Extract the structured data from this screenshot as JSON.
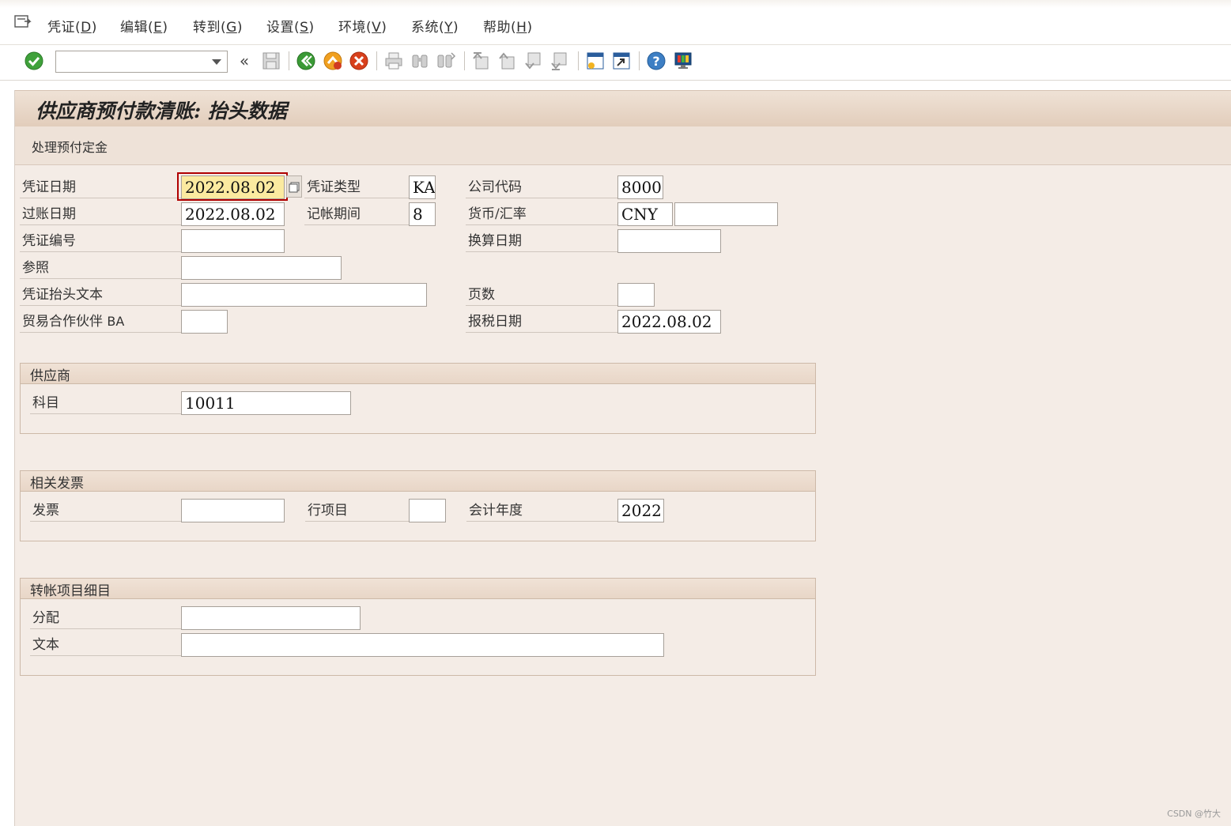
{
  "menubar": {
    "items": [
      {
        "label": "凭证",
        "key": "D"
      },
      {
        "label": "编辑",
        "key": "E"
      },
      {
        "label": "转到",
        "key": "G"
      },
      {
        "label": "设置",
        "key": "S"
      },
      {
        "label": "环境",
        "key": "V"
      },
      {
        "label": "系统",
        "key": "Y"
      },
      {
        "label": "帮助",
        "key": "H"
      }
    ]
  },
  "toolbar": {
    "command_field_value": "",
    "nav_arrows": "«"
  },
  "colors": {
    "title_bar": "#e2cdbb",
    "work_area": "#f4ece6",
    "focused_field": "#fbeaa0",
    "focus_frame": "#b00000"
  },
  "screen": {
    "title": "供应商预付款清账: 抬头数据",
    "app_button": "处理预付定金"
  },
  "header": {
    "doc_date_label": "凭证日期",
    "doc_date_value": "2022.08.02",
    "doc_type_label": "凭证类型",
    "doc_type_value": "KA",
    "company_code_label": "公司代码",
    "company_code_value": "8000",
    "posting_date_label": "过账日期",
    "posting_date_value": "2022.08.02",
    "period_label": "记帐期间",
    "period_value": "8",
    "currency_label": "货币/汇率",
    "currency_value": "CNY",
    "exchange_rate_value": "",
    "doc_number_label": "凭证编号",
    "doc_number_value": "",
    "translation_date_label": "换算日期",
    "translation_date_value": "",
    "reference_label": "参照",
    "reference_value": "",
    "header_text_label": "凭证抬头文本",
    "header_text_value": "",
    "page_count_label": "页数",
    "page_count_value": "",
    "trading_partner_label_cn": "贸易合作伙伴",
    "trading_partner_label_latin": "BA",
    "trading_partner_value": "",
    "tax_date_label": "报税日期",
    "tax_date_value": "2022.08.02"
  },
  "vendor_group": {
    "title": "供应商",
    "account_label": "科目",
    "account_value": "10011"
  },
  "invoice_group": {
    "title": "相关发票",
    "invoice_label": "发票",
    "invoice_value": "",
    "line_item_label": "行项目",
    "line_item_value": "",
    "fiscal_year_label": "会计年度",
    "fiscal_year_value": "2022"
  },
  "transfer_group": {
    "title": "转帐项目细目",
    "assignment_label": "分配",
    "assignment_value": "",
    "text_label": "文本",
    "text_value": ""
  },
  "watermark": "CSDN @竹大"
}
